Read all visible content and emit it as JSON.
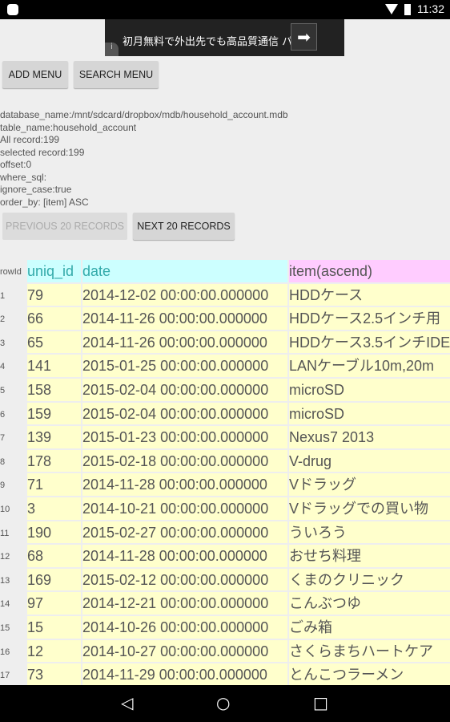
{
  "status": {
    "time": "11:32"
  },
  "ad": {
    "text": "初月無料で外出先でも高品質通信 パソ",
    "info": "i",
    "arrow": "➡"
  },
  "buttons": {
    "add_menu": "ADD MENU",
    "search_menu": "SEARCH MENU",
    "previous": "PREVIOUS 20 RECORDS",
    "next": "NEXT 20 RECORDS"
  },
  "info": [
    "database_name:/mnt/sdcard/dropbox/mdb/household_account.mdb",
    "table_name:household_account",
    "All record:199",
    "selected record:199",
    "offset:0",
    "where_sql:",
    "ignore_case:true",
    "order_by: [item] ASC"
  ],
  "table": {
    "headers": [
      "rowId",
      "uniq_id",
      "date",
      "item(ascend)"
    ],
    "rows": [
      [
        "1",
        "79",
        "2014-12-02 00:00:00.000000",
        "HDDケース"
      ],
      [
        "2",
        "66",
        "2014-11-26 00:00:00.000000",
        "HDDケース2.5インチ用"
      ],
      [
        "3",
        "65",
        "2014-11-26 00:00:00.000000",
        "HDDケース3.5インチIDE"
      ],
      [
        "4",
        "141",
        "2015-01-25 00:00:00.000000",
        "LANケーブル10m,20m"
      ],
      [
        "5",
        "158",
        "2015-02-04 00:00:00.000000",
        "microSD"
      ],
      [
        "6",
        "159",
        "2015-02-04 00:00:00.000000",
        "microSD"
      ],
      [
        "7",
        "139",
        "2015-01-23 00:00:00.000000",
        "Nexus7 2013"
      ],
      [
        "8",
        "178",
        "2015-02-18 00:00:00.000000",
        "V-drug"
      ],
      [
        "9",
        "71",
        "2014-11-28 00:00:00.000000",
        "Vドラッグ"
      ],
      [
        "10",
        "3",
        "2014-10-21 00:00:00.000000",
        "Vドラッグでの買い物"
      ],
      [
        "11",
        "190",
        "2015-02-27 00:00:00.000000",
        "ういろう"
      ],
      [
        "12",
        "68",
        "2014-11-28 00:00:00.000000",
        "おせち料理"
      ],
      [
        "13",
        "169",
        "2015-02-12 00:00:00.000000",
        "くまのクリニック"
      ],
      [
        "14",
        "97",
        "2014-12-21 00:00:00.000000",
        "こんぶつゆ"
      ],
      [
        "15",
        "15",
        "2014-10-26 00:00:00.000000",
        "ごみ箱"
      ],
      [
        "16",
        "12",
        "2014-10-27 00:00:00.000000",
        "さくらまちハートケア"
      ],
      [
        "17",
        "73",
        "2014-11-29 00:00:00.000000",
        "とんこつラーメン"
      ]
    ]
  }
}
